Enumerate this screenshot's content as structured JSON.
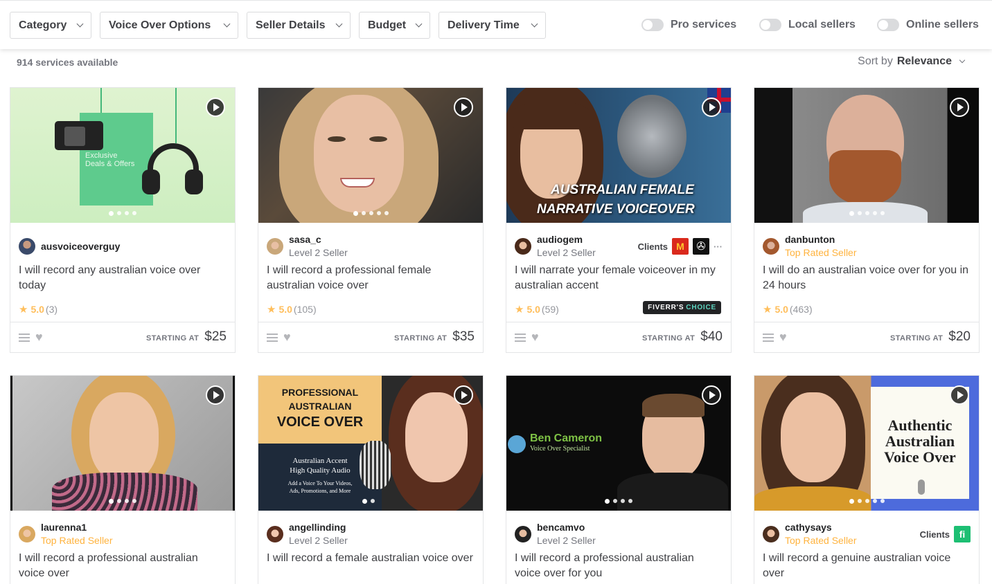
{
  "filters": {
    "buttons": [
      "Category",
      "Voice Over Options",
      "Seller Details",
      "Budget",
      "Delivery Time"
    ],
    "toggles": [
      "Pro services",
      "Local sellers",
      "Online sellers"
    ]
  },
  "results": {
    "count": "914 services available",
    "sort_label": "Sort by",
    "sort_value": "Relevance"
  },
  "labels": {
    "starting_at": "STARTING AT",
    "clients": "Clients"
  },
  "cards": [
    {
      "username": "ausvoiceoverguy",
      "level": "",
      "title": "I will record any australian voice over today",
      "rating": "5.0",
      "reviews": "(3)",
      "price": "$25",
      "thumb_text": [
        "Exclusive",
        "Deals & Offers"
      ]
    },
    {
      "username": "sasa_c",
      "level": "Level 2 Seller",
      "title": "I will record a professional female australian voice over",
      "rating": "5.0",
      "reviews": "(105)",
      "price": "$35"
    },
    {
      "username": "audiogem",
      "level": "Level 2 Seller",
      "title": "I will narrate your female voiceover in my australian accent",
      "rating": "5.0",
      "reviews": "(59)",
      "price": "$40",
      "badge": [
        "FIVERR'S",
        "CHOICE"
      ],
      "thumb_text": [
        "AUSTRALIAN FEMALE",
        "NARRATIVE VOICEOVER"
      ]
    },
    {
      "username": "danbunton",
      "level": "Top Rated Seller",
      "title": "I will do an australian voice over for you in 24 hours",
      "rating": "5.0",
      "reviews": "(463)",
      "price": "$20"
    },
    {
      "username": "laurenna1",
      "level": "Top Rated Seller",
      "title": "I will record a professional australian voice over"
    },
    {
      "username": "angellinding",
      "level": "Level 2 Seller",
      "title": "I will record a female australian voice over",
      "thumb_text": [
        "PROFESSIONAL",
        "AUSTRALIAN",
        "VOICE OVER",
        "Australian Accent",
        "High Quality Audio",
        "Add a Voice To Your Videos,",
        "Ads, Promotions, and More"
      ]
    },
    {
      "username": "bencamvo",
      "level": "Level 2 Seller",
      "title": "I will record a professional australian voice over for you",
      "thumb_text": [
        "Ben Cameron",
        "Voice Over Specialist"
      ]
    },
    {
      "username": "cathysays",
      "level": "Top Rated Seller",
      "title": "I will record a genuine australian voice over",
      "thumb_text": [
        "Authentic",
        "Australian",
        "Voice Over"
      ]
    }
  ],
  "colors": {
    "top_rated": "#ffb33e",
    "star": "#ffbe5b",
    "badge_accent": "#5cd3be"
  }
}
